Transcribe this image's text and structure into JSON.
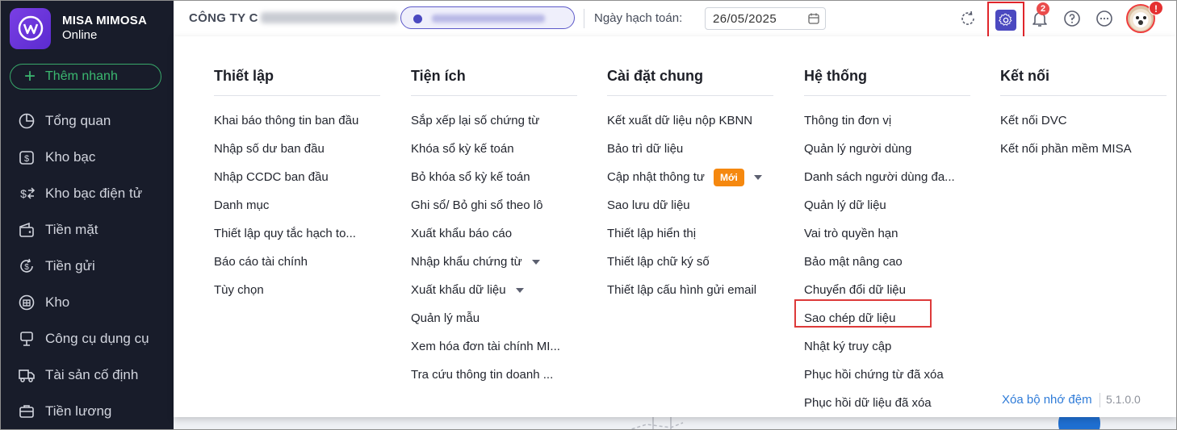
{
  "brand": {
    "name": "MISA MIMOSA",
    "sub": "Online"
  },
  "quick_add": {
    "label": "Thêm nhanh"
  },
  "nav": [
    {
      "label": "Tổng quan",
      "icon": "pie-chart-icon"
    },
    {
      "label": "Kho bạc",
      "icon": "dollar-box-icon"
    },
    {
      "label": "Kho bạc điện tử",
      "icon": "dollar-transfer-icon"
    },
    {
      "label": "Tiền mặt",
      "icon": "wallet-icon"
    },
    {
      "label": "Tiền gửi",
      "icon": "dollar-refresh-icon"
    },
    {
      "label": "Kho",
      "icon": "warehouse-icon"
    },
    {
      "label": "Công cụ dụng cụ",
      "icon": "tool-icon"
    },
    {
      "label": "Tài sản cố định",
      "icon": "truck-icon"
    },
    {
      "label": "Tiền lương",
      "icon": "briefcase-icon"
    }
  ],
  "topbar": {
    "company_prefix": "CÔNG TY C",
    "date_label": "Ngày hạch toán:",
    "date_value": "26/05/2025",
    "notification_count": "2",
    "avatar_alert": "!"
  },
  "menu": {
    "columns": [
      {
        "title": "Thiết lập",
        "items": [
          {
            "label": "Khai báo thông tin ban đầu"
          },
          {
            "label": "Nhập số dư ban đầu"
          },
          {
            "label": "Nhập CCDC ban đầu"
          },
          {
            "label": "Danh mục"
          },
          {
            "label": "Thiết lập quy tắc hạch to..."
          },
          {
            "label": "Báo cáo tài chính"
          },
          {
            "label": "Tùy chọn"
          }
        ]
      },
      {
        "title": "Tiện ích",
        "items": [
          {
            "label": "Sắp xếp lại số chứng từ"
          },
          {
            "label": "Khóa sổ kỳ kế toán"
          },
          {
            "label": "Bỏ khóa sổ kỳ kế toán"
          },
          {
            "label": "Ghi sổ/ Bỏ ghi sổ theo lô"
          },
          {
            "label": "Xuất khẩu báo cáo"
          },
          {
            "label": "Nhập khẩu chứng từ",
            "dropdown": true
          },
          {
            "label": "Xuất khẩu dữ liệu",
            "dropdown": true
          },
          {
            "label": "Quản lý mẫu"
          },
          {
            "label": "Xem hóa đơn tài chính MI..."
          },
          {
            "label": "Tra cứu thông tin doanh ..."
          }
        ]
      },
      {
        "title": "Cài đặt chung",
        "items": [
          {
            "label": "Kết xuất dữ liệu nộp KBNN"
          },
          {
            "label": "Bảo trì dữ liệu"
          },
          {
            "label": "Cập nhật thông tư",
            "badge": "Mới",
            "dropdown": true
          },
          {
            "label": "Sao lưu dữ liệu"
          },
          {
            "label": "Thiết lập hiển thị"
          },
          {
            "label": "Thiết lập chữ ký số"
          },
          {
            "label": "Thiết lập cấu hình gửi email"
          }
        ]
      },
      {
        "title": "Hệ thống",
        "items": [
          {
            "label": "Thông tin đơn vị"
          },
          {
            "label": "Quản lý người dùng"
          },
          {
            "label": "Danh sách người dùng đa..."
          },
          {
            "label": "Quản lý dữ liệu"
          },
          {
            "label": "Vai trò quyền hạn"
          },
          {
            "label": "Bảo mật nâng cao"
          },
          {
            "label": "Chuyển đổi dữ liệu"
          },
          {
            "label": "Sao chép dữ liệu",
            "highlighted": true
          },
          {
            "label": "Nhật ký truy cập"
          },
          {
            "label": "Phục hồi chứng từ đã xóa"
          },
          {
            "label": "Phục hồi dữ liệu đã xóa"
          }
        ]
      },
      {
        "title": "Kết nối",
        "items": [
          {
            "label": "Kết nối DVC"
          },
          {
            "label": "Kết nối phần mềm MISA"
          }
        ]
      }
    ],
    "footer": {
      "clear_cache": "Xóa bộ nhớ đệm",
      "version": "5.1.0.0"
    }
  },
  "colors": {
    "sidebar_bg": "#181c2a",
    "accent": "#4b49c0",
    "highlight": "#dd3a3a",
    "new_badge": "#f5880f",
    "quick_add": "#38a86a",
    "link": "#2e7bd8"
  }
}
